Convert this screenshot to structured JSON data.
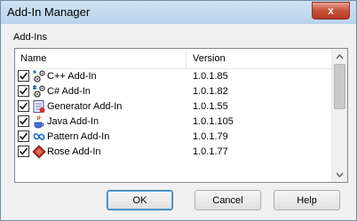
{
  "window": {
    "title": "Add-In Manager",
    "close_glyph": "x"
  },
  "group": {
    "label": "Add-Ins"
  },
  "list": {
    "headers": {
      "name": "Name",
      "version": "Version"
    },
    "rows": [
      {
        "name": "C++ Add-In",
        "version": "1.0.1.85",
        "checked": true,
        "icon": "cpp-addin-icon"
      },
      {
        "name": "C# Add-In",
        "version": "1.0.1.82",
        "checked": true,
        "icon": "csharp-addin-icon"
      },
      {
        "name": "Generator Add-In",
        "version": "1.0.1.55",
        "checked": true,
        "icon": "generator-addin-icon"
      },
      {
        "name": "Java Add-In",
        "version": "1.0.1.105",
        "checked": true,
        "icon": "java-addin-icon"
      },
      {
        "name": "Pattern Add-In",
        "version": "1.0.1.79",
        "checked": true,
        "icon": "pattern-addin-icon"
      },
      {
        "name": "Rose Add-In",
        "version": "1.0.1.77",
        "checked": true,
        "icon": "rose-addin-icon"
      }
    ]
  },
  "buttons": {
    "ok": "OK",
    "cancel": "Cancel",
    "help": "Help"
  }
}
